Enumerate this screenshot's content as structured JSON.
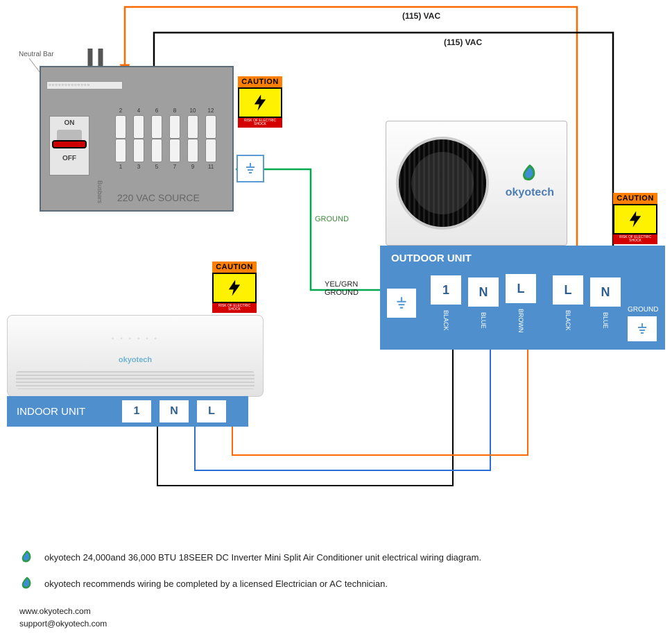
{
  "wires": {
    "line1_label": "(115) VAC",
    "line2_label": "(115) VAC",
    "ground_label": "GROUND",
    "ground_wire_label": "YEL/GRN\nGROUND"
  },
  "caution": {
    "banner": "CAUTION",
    "strip": "RISK OF ELECTRIC SHOCK"
  },
  "panel": {
    "neutral_label": "Neutral\nBar",
    "busbars_label": "Busbars",
    "on_label": "ON",
    "off_label": "OFF",
    "source_label": "220 VAC SOURCE",
    "breaker_numbers_top": [
      "2",
      "4",
      "6",
      "8",
      "10",
      "12"
    ],
    "breaker_numbers_bot": [
      "1",
      "3",
      "5",
      "7",
      "9",
      "11"
    ]
  },
  "indoor": {
    "title": "INDOOR UNIT",
    "brand": "okyotech",
    "terminals": [
      "1",
      "N",
      "L"
    ]
  },
  "outdoor": {
    "title": "OUTDOOR UNIT",
    "brand": "okyotech",
    "terminals": [
      "1",
      "N",
      "L",
      "L",
      "N"
    ],
    "wire_colors": [
      "BLACK",
      "BLUE",
      "BROWN",
      "BLACK",
      "BLUE"
    ],
    "ground_text": "GROUND"
  },
  "footer": {
    "line1": "okyotech 24,000and 36,000 BTU 18SEER DC Inverter Mini Split Air Conditioner unit electrical wiring diagram.",
    "line2": "okyotech recommends wiring be completed by a licensed Electrician or AC technician.",
    "url": "www.okyotech.com",
    "email": "support@okyotech.com"
  }
}
